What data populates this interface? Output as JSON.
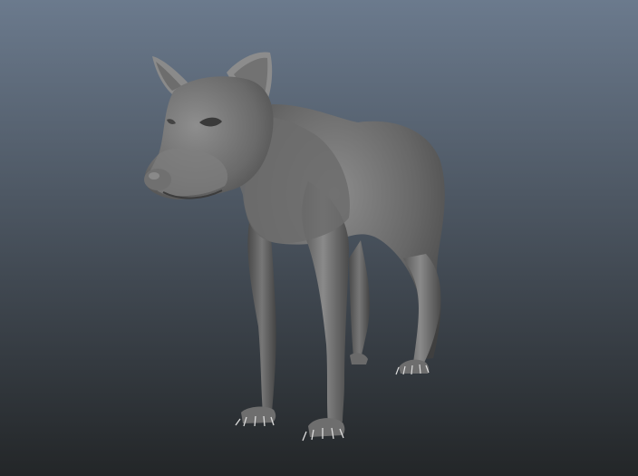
{
  "viewport": {
    "background_top": "#6b7a8d",
    "background_bottom": "#232628"
  },
  "model": {
    "subject": "wolf-model",
    "base_color": "#6a6a6a",
    "highlight_color": "#9a9a9a",
    "shadow_color": "#3c3c3c"
  }
}
